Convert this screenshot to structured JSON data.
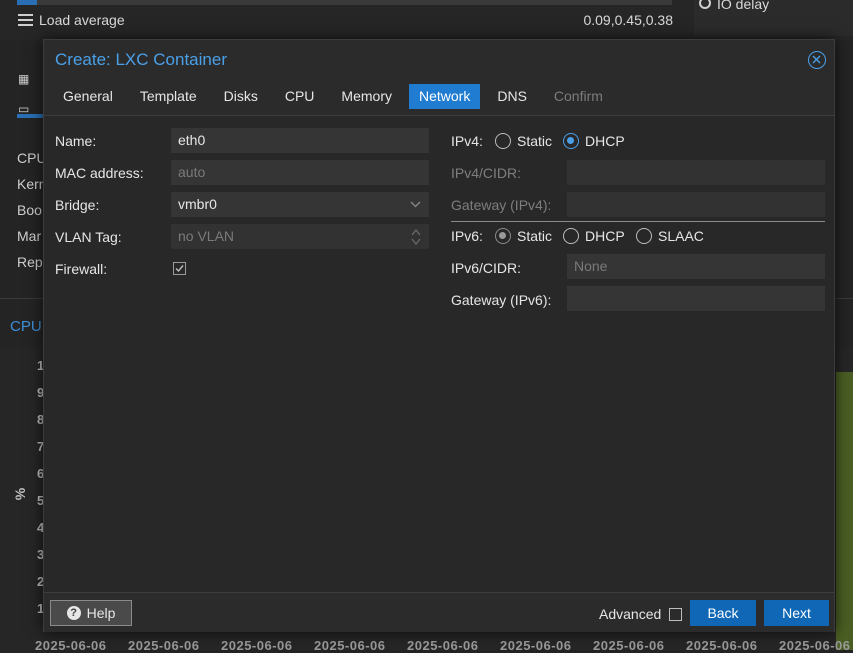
{
  "background": {
    "load_label": "Load average",
    "load_value": "0.09,0.45,0.38",
    "io_label": "IO delay",
    "side_items": [
      "CPU",
      "Kern",
      "Boo",
      "Mar",
      "Rep"
    ],
    "cpu_title": "CPU",
    "y_ticks": [
      "1",
      "9",
      "8",
      "7",
      "6",
      "5",
      "4",
      "3",
      "2",
      "1"
    ],
    "y_unit": "%",
    "x_ticks": [
      "2025-06-06",
      "2025-06-06",
      "2025-06-06",
      "2025-06-06",
      "2025-06-06",
      "2025-06-06",
      "2025-06-06",
      "2025-06-06",
      "2025-06-06"
    ]
  },
  "dialog": {
    "title": "Create: LXC Container",
    "tabs": [
      {
        "label": "General",
        "state": "normal"
      },
      {
        "label": "Template",
        "state": "normal"
      },
      {
        "label": "Disks",
        "state": "normal"
      },
      {
        "label": "CPU",
        "state": "normal"
      },
      {
        "label": "Memory",
        "state": "normal"
      },
      {
        "label": "Network",
        "state": "active"
      },
      {
        "label": "DNS",
        "state": "normal"
      },
      {
        "label": "Confirm",
        "state": "disabled"
      }
    ],
    "left": {
      "name_label": "Name:",
      "name_value": "eth0",
      "mac_label": "MAC address:",
      "mac_placeholder": "auto",
      "bridge_label": "Bridge:",
      "bridge_value": "vmbr0",
      "vlan_label": "VLAN Tag:",
      "vlan_placeholder": "no VLAN",
      "firewall_label": "Firewall:",
      "firewall_checked": true
    },
    "right": {
      "ipv4_label": "IPv4:",
      "ipv4_options": [
        "Static",
        "DHCP"
      ],
      "ipv4_selected": "DHCP",
      "ipv4_cidr_label": "IPv4/CIDR:",
      "ipv4_gw_label": "Gateway (IPv4):",
      "ipv6_label": "IPv6:",
      "ipv6_options": [
        "Static",
        "DHCP",
        "SLAAC"
      ],
      "ipv6_selected": "Static",
      "ipv6_cidr_label": "IPv6/CIDR:",
      "ipv6_cidr_placeholder": "None",
      "ipv6_gw_label": "Gateway (IPv6):"
    },
    "footer": {
      "help_label": "Help",
      "advanced_label": "Advanced",
      "back_label": "Back",
      "next_label": "Next"
    }
  },
  "colors": {
    "accent": "#1f7cd0",
    "title": "#4aa0e8",
    "button": "#0f67b5"
  }
}
